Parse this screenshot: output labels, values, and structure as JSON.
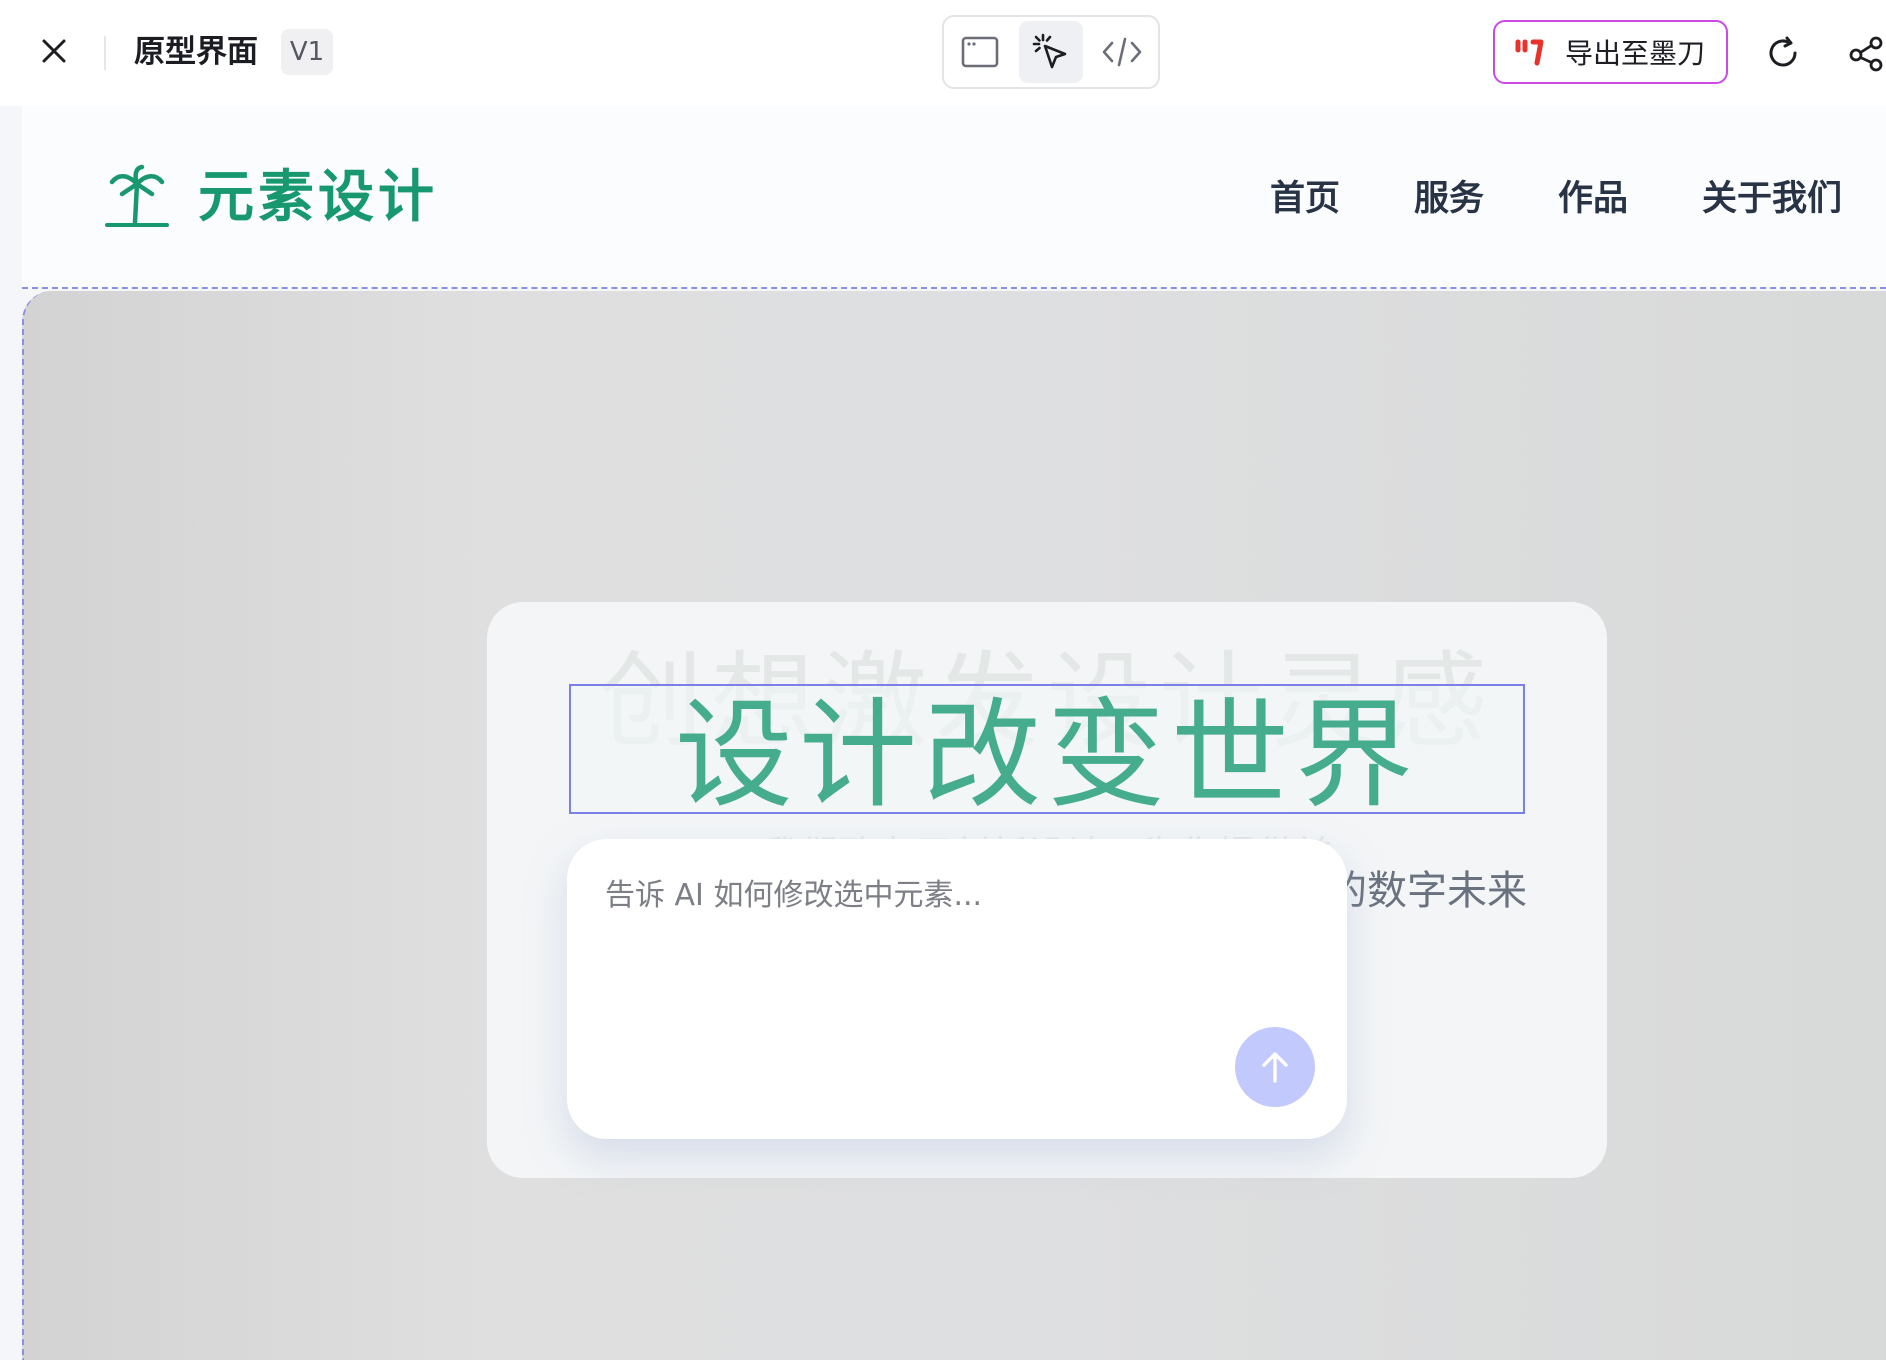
{
  "toolbar": {
    "title": "原型界面",
    "version": "V1",
    "export_label": "导出至墨刀",
    "modes": [
      {
        "name": "preview-mode",
        "icon": "window-icon"
      },
      {
        "name": "select-mode",
        "icon": "pointer-click-icon",
        "active": true
      },
      {
        "name": "code-mode",
        "icon": "code-icon"
      }
    ],
    "colors": {
      "export_border": "#c94be4",
      "mockplus_logo": "#e8322b"
    }
  },
  "site": {
    "logo_text": "元素设计",
    "brand_color": "#18986f",
    "nav": [
      "首页",
      "服务",
      "作品",
      "关于我们"
    ]
  },
  "hero": {
    "title": "设计改变世界",
    "ghost_title": "创想激发设计灵感",
    "ghost_subtitle": "我们致力于创新设计，为您提供前",
    "subtitle_tail": "的数字未来",
    "title_color": "#45ad8d"
  },
  "ai_prompt": {
    "placeholder": "告诉 AI 如何修改选中元素...",
    "value": "",
    "send_color": "#c2c9fd"
  }
}
